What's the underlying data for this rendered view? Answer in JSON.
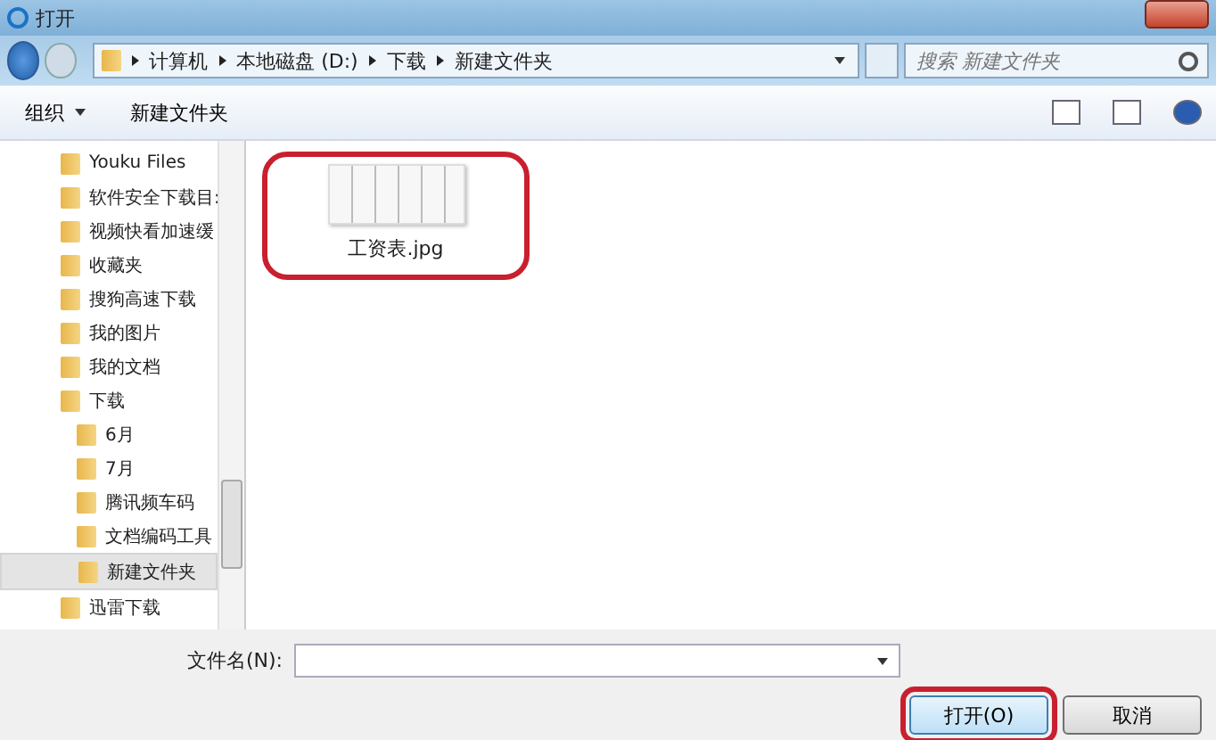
{
  "window": {
    "title": "打开"
  },
  "address_bar": {
    "path": [
      "计算机",
      "本地磁盘 (D:)",
      "下载",
      "新建文件夹"
    ]
  },
  "search": {
    "placeholder": "搜索 新建文件夹"
  },
  "toolbar": {
    "organize": "组织",
    "new_folder": "新建文件夹"
  },
  "sidebar": {
    "items": [
      {
        "label": "Youku Files",
        "selected": false
      },
      {
        "label": "软件安全下载目:",
        "selected": false
      },
      {
        "label": "视频快看加速缓",
        "selected": false
      },
      {
        "label": "收藏夹",
        "selected": false
      },
      {
        "label": "搜狗高速下载",
        "selected": false
      },
      {
        "label": "我的图片",
        "selected": false
      },
      {
        "label": "我的文档",
        "selected": false
      },
      {
        "label": "下载",
        "selected": false,
        "children": [
          {
            "label": "6月",
            "selected": false
          },
          {
            "label": "7月",
            "selected": false
          },
          {
            "label": "腾讯频车码",
            "selected": false
          },
          {
            "label": "文档编码工具",
            "selected": false
          },
          {
            "label": "新建文件夹",
            "selected": true
          }
        ]
      },
      {
        "label": "迅雷下载",
        "selected": false
      }
    ]
  },
  "files": [
    {
      "name": "工资表.jpg",
      "highlighted": true
    }
  ],
  "filename": {
    "label": "文件名(N):"
  },
  "buttons": [
    {
      "label": "打开(O)",
      "highlighted": true
    },
    {
      "label": "取消",
      "highlighted": false
    }
  ]
}
